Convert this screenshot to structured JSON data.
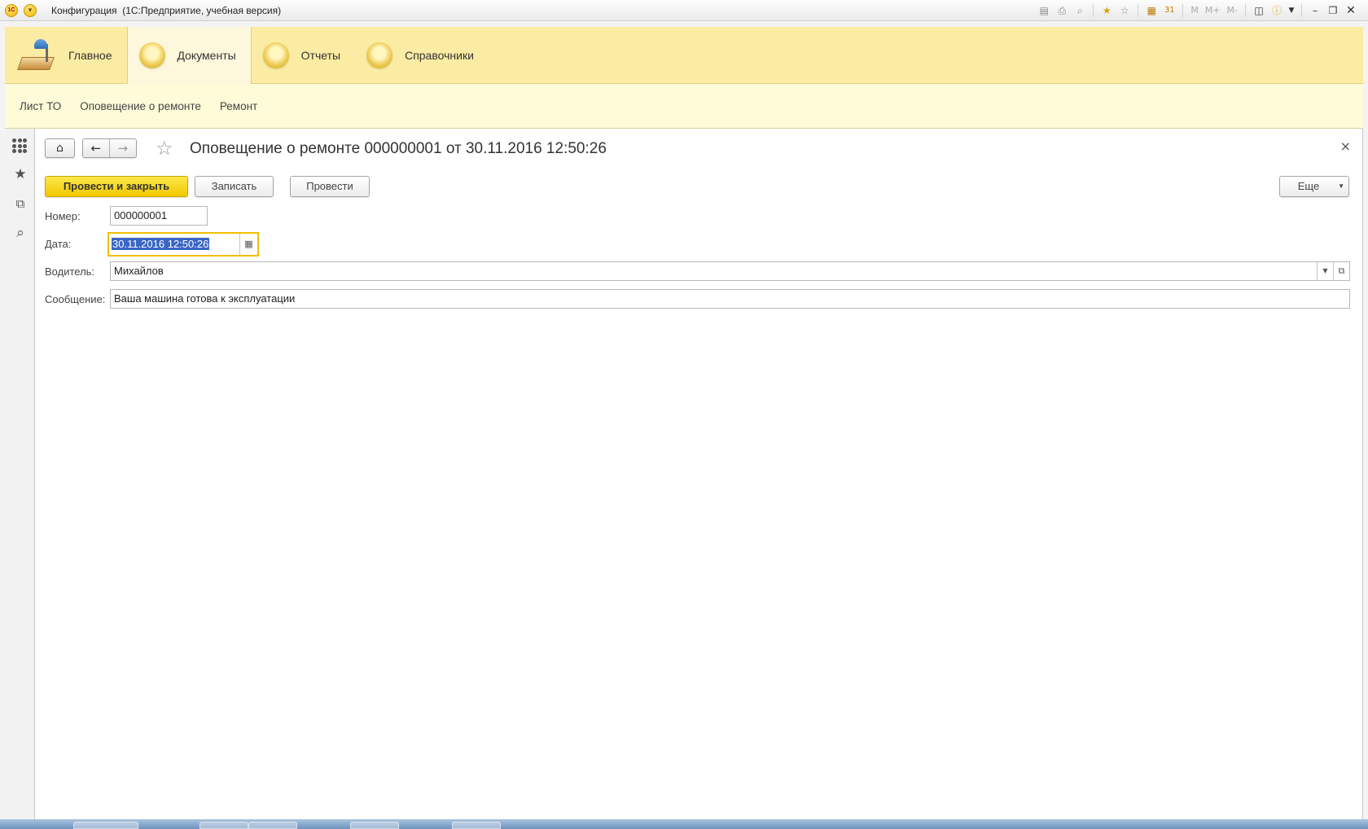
{
  "window": {
    "title": "Конфигурация  (1С:Предприятие, учебная версия)",
    "toolbar": {
      "m_label": "M",
      "m_plus_label": "M+",
      "m_minus_label": "M-"
    }
  },
  "sections": [
    {
      "label": "Главное",
      "icon": "desk-lamp-icon",
      "active": false
    },
    {
      "label": "Документы",
      "icon": "section-circle-icon",
      "active": true
    },
    {
      "label": "Отчеты",
      "icon": "section-circle-icon",
      "active": false
    },
    {
      "label": "Справочники",
      "icon": "section-circle-icon",
      "active": false
    }
  ],
  "commands": [
    "Лист ТО",
    "Оповещение о ремонте",
    "Ремонт"
  ],
  "form": {
    "title": "Оповещение о ремонте 000000001 от 30.11.2016 12:50:26",
    "buttons": {
      "post_close": "Провести и закрыть",
      "save": "Записать",
      "post": "Провести",
      "more": "Еще"
    },
    "fields": {
      "number": {
        "label": "Номер:",
        "value": "000000001"
      },
      "date": {
        "label": "Дата:",
        "value": "30.11.2016 12:50:26"
      },
      "driver": {
        "label": "Водитель:",
        "value": "Михайлов"
      },
      "message": {
        "label": "Сообщение:",
        "value": "Ваша машина готова к эксплуатации"
      }
    }
  },
  "colors": {
    "section_bg": "#fbeca3",
    "command_bg": "#fefbd9",
    "primary_button": "#f1c800",
    "focus_border": "#f0c000",
    "selection": "#3a66c4"
  }
}
